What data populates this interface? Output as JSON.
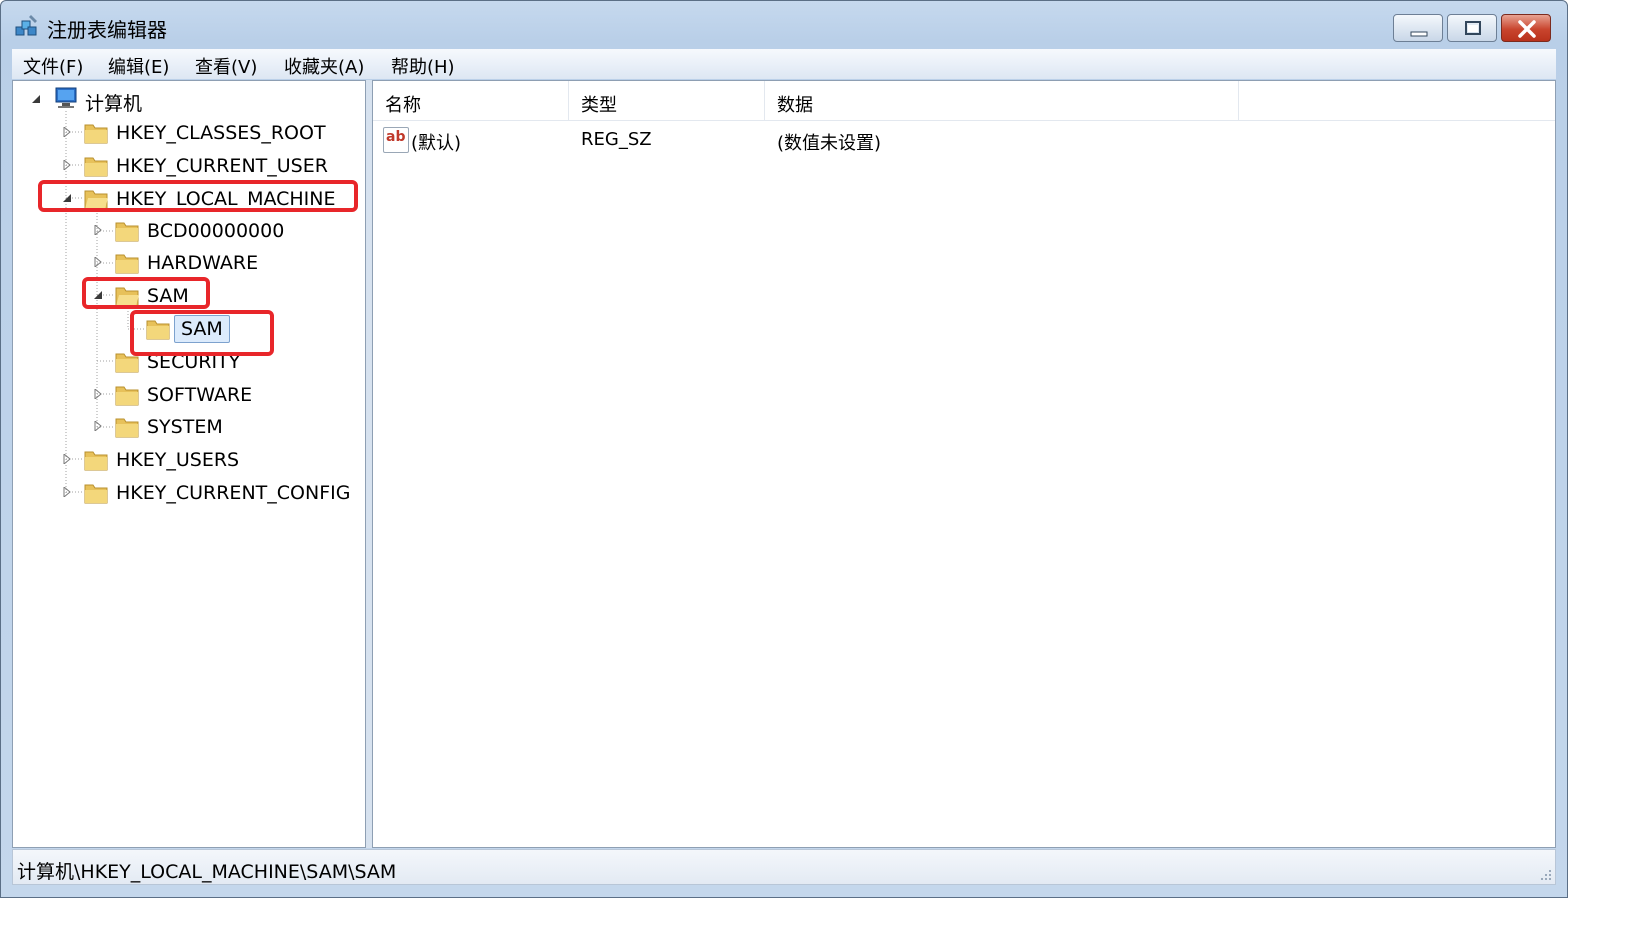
{
  "window": {
    "title": "注册表编辑器"
  },
  "menu": [
    "文件(F)",
    "编辑(E)",
    "查看(V)",
    "收藏夹(A)",
    "帮助(H)"
  ],
  "tree": {
    "root": "计算机",
    "hives": {
      "classes_root": "HKEY_CLASSES_ROOT",
      "current_user": "HKEY_CURRENT_USER",
      "local_machine": "HKEY_LOCAL_MACHINE",
      "users": "HKEY_USERS",
      "current_config": "HKEY_CURRENT_CONFIG"
    },
    "hklm_children": {
      "bcd": "BCD00000000",
      "hardware": "HARDWARE",
      "sam": "SAM",
      "sam_child": "SAM",
      "security": "SECURITY",
      "software": "SOFTWARE",
      "system": "SYSTEM"
    }
  },
  "list": {
    "columns": [
      "名称",
      "类型",
      "数据"
    ],
    "rows": [
      {
        "icon": "string-value-icon",
        "icon_text": "ab",
        "name": "(默认)",
        "type": "REG_SZ",
        "data": "(数值未设置)"
      }
    ]
  },
  "status": {
    "path": "计算机\\HKEY_LOCAL_MACHINE\\SAM\\SAM"
  },
  "colors": {
    "highlight": "#e8262a",
    "folder": "#e7c15a",
    "selection": "#dcebfc"
  }
}
